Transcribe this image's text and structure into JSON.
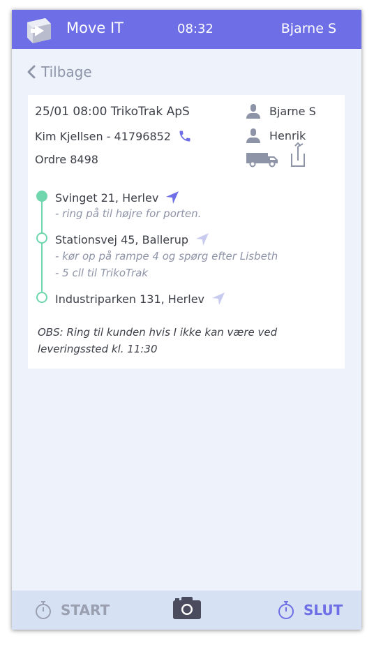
{
  "header": {
    "app_title": "Move IT",
    "time": "08:32",
    "user": "Bjarne S"
  },
  "nav": {
    "back_label": "Tilbage"
  },
  "job": {
    "title": "25/01 08:00 TrikoTrak ApS",
    "contact": "Kim Kjellsen - 41796852",
    "order": "Ordre 8498",
    "crew": [
      "Bjarne S",
      "Henrik"
    ]
  },
  "stops": [
    {
      "name": "Svinget 21, Herlev",
      "notes": [
        "- ring på til højre for porten."
      ]
    },
    {
      "name": "Stationsvej 45, Ballerup",
      "notes": [
        "- kør op på rampe 4 og spørg efter Lisbeth",
        "- 5 cll til TrikoTrak"
      ]
    },
    {
      "name": "Industriparken 131, Herlev",
      "notes": []
    }
  ],
  "obs": "OBS: Ring til kunden hvis I ikke kan være ved leveringssted kl. 11:30",
  "footer": {
    "start_label": "START",
    "end_label": "SLUT"
  },
  "colors": {
    "header": "#6e6fe6",
    "accent": "#6e6fe6",
    "route": "#6fd6ad",
    "background": "#eef3fb",
    "footer": "#d6e1f3"
  }
}
